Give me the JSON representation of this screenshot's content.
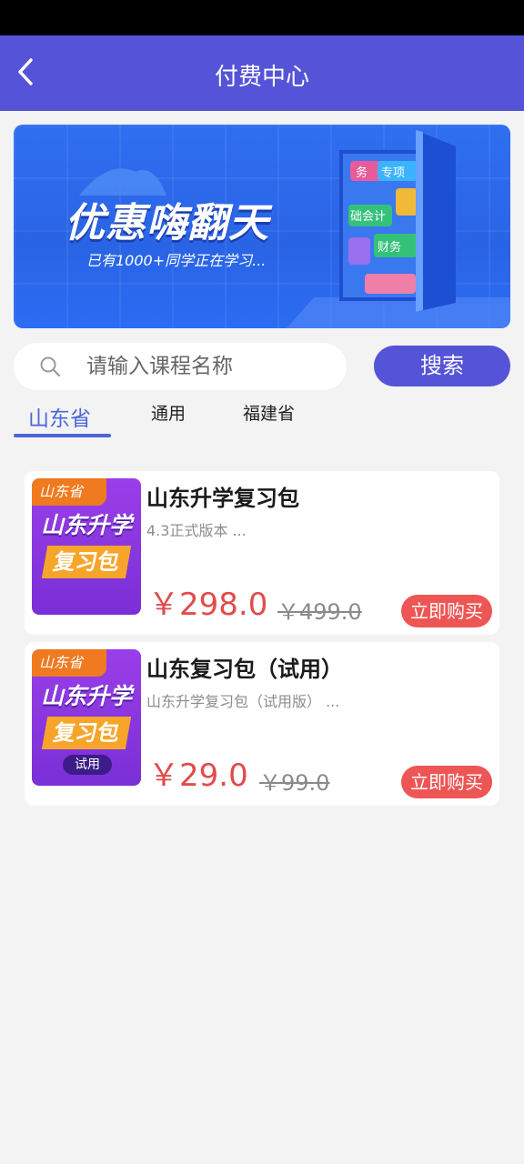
{
  "header": {
    "title": "付费中心"
  },
  "banner": {
    "headline": "优惠嗨翻天",
    "subtext": "已有1000+同学正在学习...",
    "book_labels": [
      "务",
      "专项",
      "础会计",
      "财务"
    ]
  },
  "search": {
    "placeholder": "请输入课程名称",
    "value": "",
    "button_label": "搜索"
  },
  "tabs": [
    {
      "label": "山东省",
      "active": true
    },
    {
      "label": "通用",
      "active": false
    },
    {
      "label": "福建省",
      "active": false
    }
  ],
  "products": [
    {
      "thumb_tag": "山东省",
      "thumb_line1": "山东升学",
      "thumb_line2": "复习包",
      "thumb_badge": "",
      "title": "山东升学复习包",
      "desc": "4.3正式版本 ...",
      "price": "￥298.0",
      "original_price": "￥499.0",
      "buy_label": "立即购买"
    },
    {
      "thumb_tag": "山东省",
      "thumb_line1": "山东升学",
      "thumb_line2": "复习包",
      "thumb_badge": "试用",
      "title": "山东复习包（试用）",
      "desc": "山东升学复习包（试用版） ...",
      "price": "￥29.0",
      "original_price": "￥99.0",
      "buy_label": "立即购买"
    }
  ],
  "colors": {
    "primary": "#5553d7",
    "accent_tab": "#4a66d8",
    "price": "#e24b4b",
    "buy": "#ee5555"
  }
}
